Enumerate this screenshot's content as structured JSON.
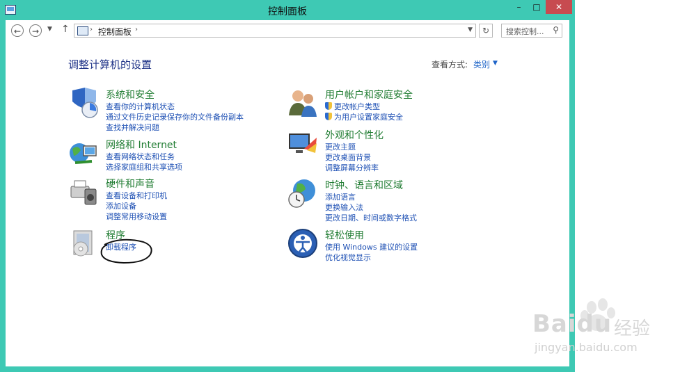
{
  "window": {
    "title": "控制面板",
    "min_label": "–",
    "max_label": "□",
    "close_label": "✕"
  },
  "address": {
    "path": "控制面板",
    "search_placeholder": "搜索控制..."
  },
  "page": {
    "heading": "调整计算机的设置",
    "view_by_label": "查看方式:",
    "view_by_value": "类别"
  },
  "categories": [
    {
      "title": "系统和安全",
      "links": [
        "查看你的计算机状态",
        "通过文件历史记录保存你的文件备份副本",
        "查找并解决问题"
      ]
    },
    {
      "title": "网络和 Internet",
      "links": [
        "查看网络状态和任务",
        "选择家庭组和共享选项"
      ]
    },
    {
      "title": "硬件和声音",
      "links": [
        "查看设备和打印机",
        "添加设备",
        "调整常用移动设置"
      ]
    },
    {
      "title": "程序",
      "links": [
        "卸载程序"
      ]
    },
    {
      "title": "用户帐户和家庭安全",
      "links": [
        "更改帐户类型",
        "为用户设置家庭安全"
      ]
    },
    {
      "title": "外观和个性化",
      "links": [
        "更改主题",
        "更改桌面背景",
        "调整屏幕分辨率"
      ]
    },
    {
      "title": "时钟、语言和区域",
      "links": [
        "添加语言",
        "更换输入法",
        "更改日期、时间或数字格式"
      ]
    },
    {
      "title": "轻松使用",
      "links": [
        "使用 Windows 建议的设置",
        "优化视觉显示"
      ]
    }
  ],
  "watermark": {
    "brand": "Bai",
    "brand2": "du",
    "cn": "经验",
    "url": "jingyan.baidu.com"
  },
  "colors": {
    "frame": "#3ec9b4",
    "close": "#c74b50",
    "category_title": "#207c32",
    "link": "#1e50b4",
    "heading": "#1e3287"
  }
}
